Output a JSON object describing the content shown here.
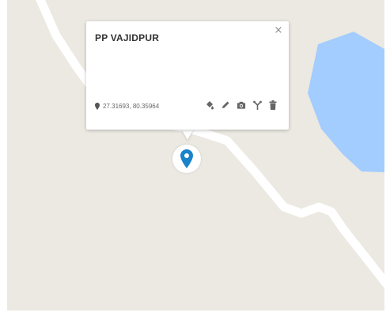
{
  "popup": {
    "title": "PP VAJIDPUR",
    "close_glyph": "×",
    "coordinates": "27.31693, 80.35964",
    "actions": [
      {
        "icon": "paint-bucket-icon"
      },
      {
        "icon": "pencil-icon"
      },
      {
        "icon": "camera-icon"
      },
      {
        "icon": "route-icon"
      },
      {
        "icon": "trash-icon"
      }
    ]
  },
  "map": {
    "land_color": "#ebe9e1",
    "road_color": "#ffffff",
    "water_color": "#a3ccff",
    "marker_color": "#1a83c9"
  }
}
